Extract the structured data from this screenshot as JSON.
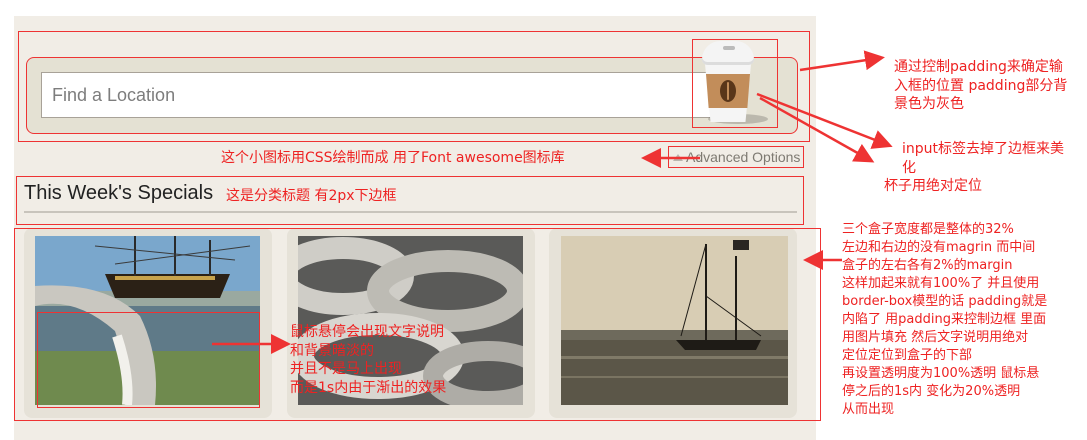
{
  "search": {
    "placeholder": "Find a Location"
  },
  "advanced_options": {
    "label": "Advanced Options"
  },
  "specials": {
    "title": "This Week's Specials"
  },
  "gallery": {
    "images": [
      {
        "alt": "Tall ship in harbor with rope"
      },
      {
        "alt": "Coiled braided rope"
      },
      {
        "alt": "Sailing schooner on water"
      }
    ]
  },
  "annotations": {
    "padding_note": [
      "通过控制padding来确定输",
      "入框的位置 padding部分背",
      "景色为灰色"
    ],
    "input_note": [
      "input标签去掉了边框来美",
      "化"
    ],
    "cup_note": "杯子用绝对定位",
    "icon_note": "这个小图标用CSS绘制而成 用了Font awesome图标库",
    "heading_note": "这是分类标题 有2px下边框",
    "hover_note": [
      "鼠标悬停会出现文字说明",
      "和背景暗淡的",
      "并且不是马上出现",
      "而是1s内由于渐出的效果"
    ],
    "layout_note": [
      "三个盒子宽度都是整体的32%",
      "左边和右边的没有magrin 而中间",
      "盒子的左右各有2%的margin",
      "这样加起来就有100%了 并且使用",
      "border-box模型的话 padding就是",
      "内陷了 用padding来控制边框 里面",
      "用图片填充 然后文字说明用绝对",
      "定位定位到盒子的下部",
      "再设置透明度为100%透明 鼠标悬",
      "停之后的1s内 变化为20%透明",
      "从而出现"
    ]
  },
  "colors": {
    "panel": "#f1ede6",
    "annotation": "#ee2222",
    "sleeve": "#c28d5a"
  }
}
